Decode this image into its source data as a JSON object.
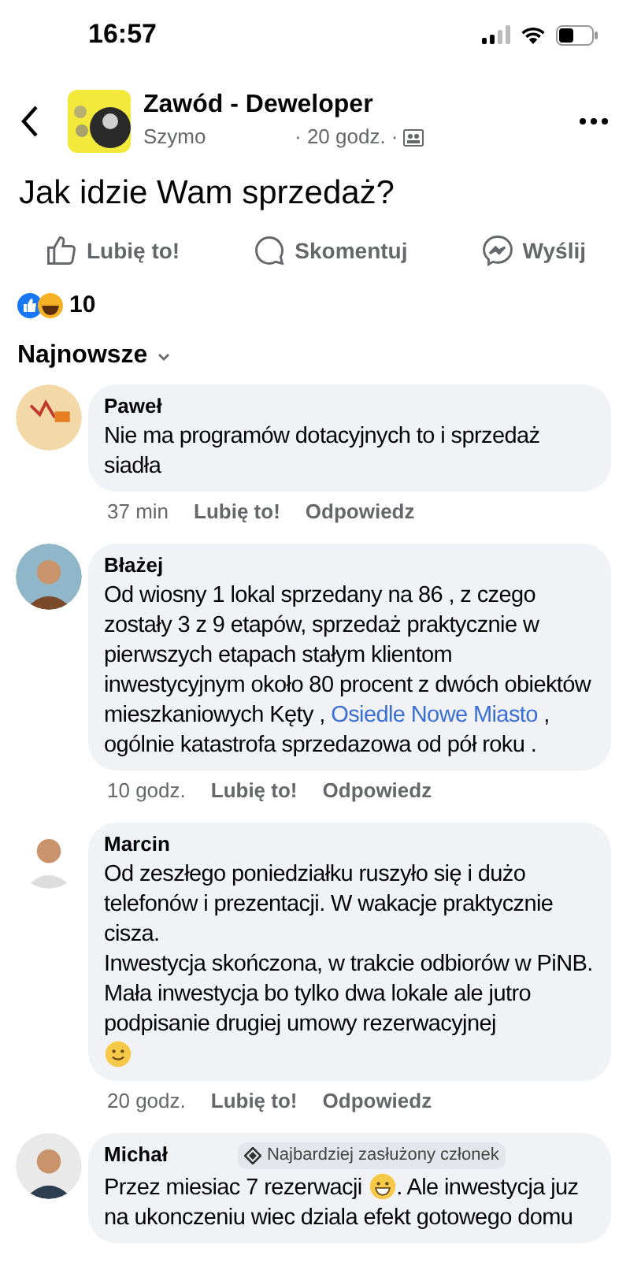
{
  "status_bar": {
    "time": "16:57"
  },
  "header": {
    "group_name": "Zawód - Deweloper",
    "author": "Szymo",
    "time": "· 20 godz. ·"
  },
  "post": {
    "text": "Jak idzie Wam sprzedaż?"
  },
  "actions": [
    {
      "label": "Lubię to!",
      "kind": "like"
    },
    {
      "label": "Skomentuj",
      "kind": "comment"
    },
    {
      "label": "Wyślij",
      "kind": "send"
    }
  ],
  "reactions": {
    "count": "10"
  },
  "sort": {
    "label": "Najnowsze"
  },
  "comments": [
    {
      "author": "Paweł",
      "parts": [
        {
          "kind": "text",
          "text": "Nie ma programów dotacyjnych to i sprzedaż siadła"
        }
      ],
      "time": "37 min",
      "like": "Lubię to!",
      "reply": "Odpowiedz"
    },
    {
      "author": "Błażej",
      "parts": [
        {
          "kind": "text",
          "text": "Od wiosny 1 lokal sprzedany na 86 , z czego zostały 3 z 9 etapów,  sprzedaż praktycznie w pierwszych etapach stałym klientom inwestycyjnym około 80 procent z dwóch obiektów mieszkaniowych Kęty , "
        },
        {
          "kind": "link",
          "text": "Osiedle Nowe Miasto"
        },
        {
          "kind": "text",
          "text": "  , ogólnie katastrofa sprzedazowa od pół roku ."
        }
      ],
      "time": "10 godz.",
      "like": "Lubię to!",
      "reply": "Odpowiedz"
    },
    {
      "author": "Marcin",
      "parts": [
        {
          "kind": "text",
          "text": "Od zeszłego poniedziałku ruszyło się i dużo telefonów i prezentacji. W wakacje praktycznie cisza."
        },
        {
          "kind": "break"
        },
        {
          "kind": "text",
          "text": "Inwestycja skończona, w trakcie odbiorów w PiNB. Mała inwestycja bo tylko dwa lokale ale jutro podpisanie drugiej umowy rezerwacyjnej"
        },
        {
          "kind": "break"
        },
        {
          "kind": "emoji_smile"
        }
      ],
      "time": "20 godz.",
      "like": "Lubię to!",
      "reply": "Odpowiedz"
    },
    {
      "author": "Michał",
      "badge": "Najbardziej zasłużony członek",
      "parts": [
        {
          "kind": "text",
          "text": "Przez miesiac 7 rezerwacji "
        },
        {
          "kind": "emoji_grin"
        },
        {
          "kind": "text",
          "text": ". Ale inwestycja juz na ukonczeniu wiec dziala efekt gotowego domu"
        }
      ]
    }
  ]
}
